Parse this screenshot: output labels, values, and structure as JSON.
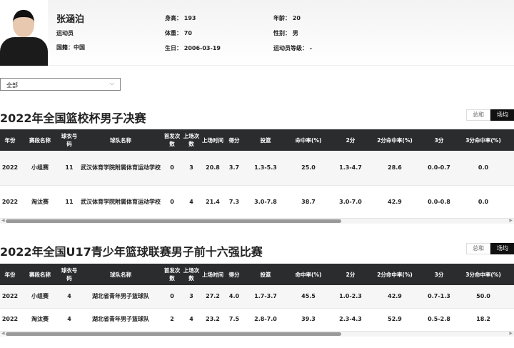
{
  "player": {
    "name": "张涵泊",
    "role": "运动员",
    "nationality": "国籍：中国",
    "height": "身高：  193",
    "weight": "体重：  70",
    "birthday": "生日：  2006-03-19",
    "age": "年龄：  20",
    "gender": "性别：  男",
    "level": "运动员等级：  -",
    "photo_logo": "Columbia"
  },
  "filter": {
    "value": "全部"
  },
  "tabs": [
    "总和",
    "场均"
  ],
  "active_tab": "场均",
  "columns": [
    "年份",
    "赛段名称",
    "球衣号码",
    "球队名称",
    "首发次数",
    "上场次数",
    "上场时间",
    "得分",
    "投篮",
    "命中率(%)",
    "2分",
    "2分命中率(%)",
    "3分",
    "3分命中率(%)"
  ],
  "sections": [
    {
      "title": "2022年全国篮校杯男子决赛",
      "rows": [
        [
          "2022",
          "小组赛",
          "11",
          "武汉体育学院附属体育运动学校",
          "0",
          "3",
          "20.8",
          "3.7",
          "1.3-5.3",
          "25.0",
          "1.3-4.7",
          "28.6",
          "0.0-0.7",
          "0.0"
        ],
        [
          "2022",
          "淘汰赛",
          "11",
          "武汉体育学院附属体育运动学校",
          "0",
          "4",
          "21.4",
          "7.3",
          "3.0-7.8",
          "38.7",
          "3.0-7.0",
          "42.9",
          "0.0-0.8",
          "0.0"
        ]
      ]
    },
    {
      "title": "2022年全国U17青少年篮球联赛男子前十六强比赛",
      "rows": [
        [
          "2022",
          "小组赛",
          "4",
          "湖北省青年男子篮球队",
          "0",
          "3",
          "27.2",
          "4.0",
          "1.7-3.7",
          "45.5",
          "1.0-2.3",
          "42.9",
          "0.7-1.3",
          "50.0"
        ],
        [
          "2022",
          "淘汰赛",
          "4",
          "湖北省青年男子篮球队",
          "2",
          "4",
          "23.2",
          "7.5",
          "2.8-7.0",
          "39.3",
          "2.3-4.3",
          "52.9",
          "0.5-2.8",
          "18.2"
        ]
      ]
    }
  ]
}
